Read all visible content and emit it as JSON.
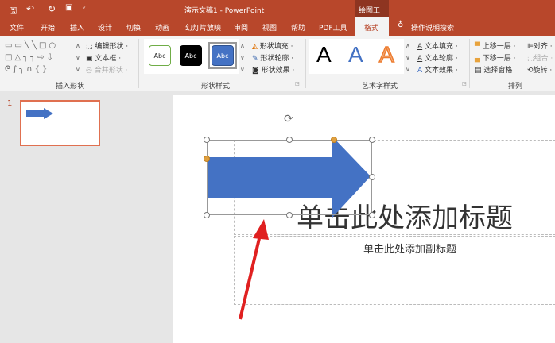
{
  "window": {
    "title": "演示文稿1 - PowerPoint",
    "context_tab_group": "绘图工具"
  },
  "quick_access": {
    "save_icon": "save-icon",
    "undo_icon": "undo-icon",
    "redo_icon": "redo-icon"
  },
  "tabs": [
    {
      "label": "文件"
    },
    {
      "label": "开始"
    },
    {
      "label": "插入"
    },
    {
      "label": "设计"
    },
    {
      "label": "切换"
    },
    {
      "label": "动画"
    },
    {
      "label": "幻灯片放映"
    },
    {
      "label": "审阅"
    },
    {
      "label": "视图"
    },
    {
      "label": "帮助"
    },
    {
      "label": "PDF工具"
    },
    {
      "label": "格式",
      "active": true
    }
  ],
  "search": {
    "label": "操作说明搜索"
  },
  "ribbon": {
    "insert_shapes": {
      "label": "插入形状",
      "edit_shape": "编辑形状 ·",
      "text_box": "文本框 ·",
      "merge_shapes": "合并形状 ·"
    },
    "shape_styles": {
      "label": "形状样式",
      "samples": [
        "Abc",
        "Abc",
        "Abc"
      ],
      "fill": "形状填充 ·",
      "outline": "形状轮廓 ·",
      "effects": "形状效果 ·"
    },
    "wordart_styles": {
      "label": "艺术字样式",
      "samples": [
        "A",
        "A",
        "A"
      ],
      "text_fill": "文本填充 ·",
      "text_outline": "文本轮廓 ·",
      "text_effects": "文本效果 ·"
    },
    "arrange": {
      "label": "排列",
      "bring_forward": "上移一层 ·",
      "send_backward": "下移一层 ·",
      "selection_pane": "选择窗格",
      "align": "对齐 ·",
      "group": "组合 ·",
      "rotate": "旋转 ·"
    }
  },
  "slides_pane": {
    "slide_number": "1"
  },
  "slide": {
    "title_placeholder": "单击此处添加标题",
    "subtitle_placeholder": "单击此处添加副标题"
  },
  "colors": {
    "accent": "#b8472b",
    "shape_fill": "#4472c4",
    "annotation": "#e02020"
  }
}
